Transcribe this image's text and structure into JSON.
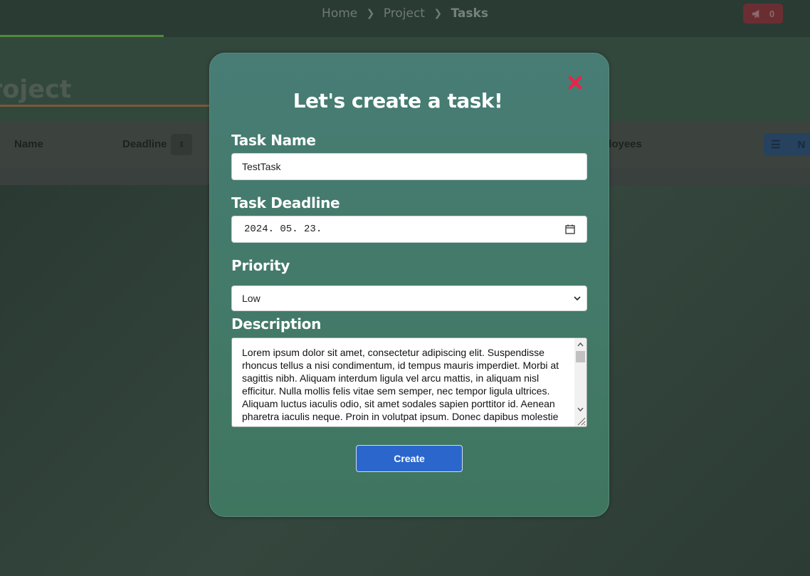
{
  "breadcrumb": {
    "items": [
      "Home",
      "Project"
    ],
    "current": "Tasks"
  },
  "notifications": {
    "count": "0"
  },
  "page": {
    "heading": "roject"
  },
  "table": {
    "columns": {
      "name": "Name",
      "deadline": "Deadline",
      "employees": "ployees"
    },
    "list_button_label": "N"
  },
  "modal": {
    "title": "Let's create a task!",
    "task_name_label": "Task Name",
    "task_name_value": "TestTask",
    "deadline_label": "Task Deadline",
    "deadline_value": "2024. 05. 23.",
    "priority_label": "Priority",
    "priority_value": "Low",
    "description_label": "Description",
    "description_value": "Lorem ipsum dolor sit amet, consectetur adipiscing elit. Suspendisse rhoncus tellus a nisi condimentum, id tempus mauris imperdiet. Morbi at sagittis nibh. Aliquam interdum ligula vel arcu mattis, in aliquam nisl efficitur. Nulla mollis felis vitae sem semper, nec tempor ligula ultrices. Aliquam luctus iaculis odio, sit amet sodales sapien porttitor id. Aenean pharetra iaculis neque. Proin in volutpat ipsum. Donec dapibus molestie",
    "create_label": "Create"
  },
  "colors": {
    "modal_bg": "#457b6c",
    "accent_button": "#2a66cc",
    "close_icon": "#e8244a",
    "progress": "#4e8a3c"
  },
  "icons": {
    "close": "close-icon",
    "calendar": "calendar-icon",
    "notification": "megaphone-icon",
    "sort": "sort-icon",
    "list": "list-icon",
    "dropdown": "chevron-down-icon"
  }
}
